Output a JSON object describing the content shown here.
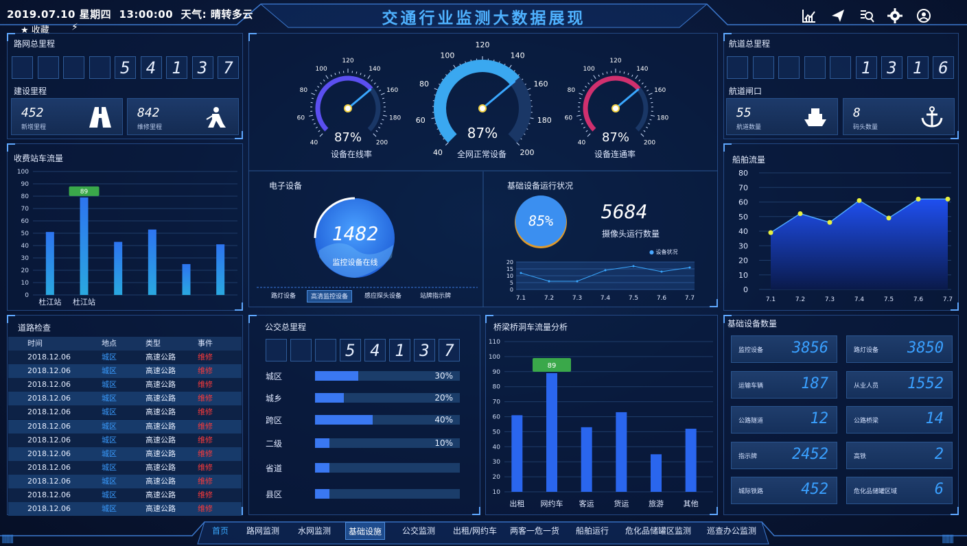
{
  "header": {
    "datetime": "2019.07.10 星期四  13:00:00  天气: 晴转多云",
    "title": "交通行业监测大数据展现",
    "favorites": "收藏"
  },
  "icons": [
    "chart-icon",
    "send-icon",
    "search-icon",
    "settings-icon",
    "user-icon"
  ],
  "road_total": {
    "title": "路网总里程",
    "digits": [
      "",
      "",
      "",
      "",
      "5",
      "4",
      "1",
      "3",
      "7"
    ]
  },
  "construction": {
    "title": "建设里程",
    "cards": [
      {
        "value": "452",
        "label": "新增里程",
        "icon": "road-icon"
      },
      {
        "value": "842",
        "label": "维修里程",
        "icon": "worker-icon"
      }
    ]
  },
  "toll": {
    "title": "收费站车流量",
    "chart_data": {
      "type": "bar",
      "categories": [
        "杜江站",
        "杜江站",
        "",
        "",
        "",
        ""
      ],
      "values": [
        51,
        79,
        43,
        53,
        25,
        41
      ],
      "ylim": [
        0,
        100
      ],
      "yticks": [
        0,
        10,
        20,
        30,
        40,
        50,
        60,
        70,
        80,
        90,
        100
      ],
      "highlight": {
        "index": 1,
        "label": "89"
      }
    }
  },
  "road_check": {
    "title": "道路检查",
    "headers": [
      "时间",
      "地点",
      "类型",
      "事件"
    ],
    "rows": [
      [
        "2018.12.06",
        "城区",
        "高速公路",
        "维修"
      ],
      [
        "2018.12.06",
        "城区",
        "高速公路",
        "维修"
      ],
      [
        "2018.12.06",
        "城区",
        "高速公路",
        "维修"
      ],
      [
        "2018.12.06",
        "城区",
        "高速公路",
        "维修"
      ],
      [
        "2018.12.06",
        "城区",
        "高速公路",
        "维修"
      ],
      [
        "2018.12.06",
        "城区",
        "高速公路",
        "维修"
      ],
      [
        "2018.12.06",
        "城区",
        "高速公路",
        "维修"
      ],
      [
        "2018.12.06",
        "城区",
        "高速公路",
        "维修"
      ],
      [
        "2018.12.06",
        "城区",
        "高速公路",
        "维修"
      ],
      [
        "2018.12.06",
        "城区",
        "高速公路",
        "维修"
      ],
      [
        "2018.12.06",
        "城区",
        "高速公路",
        "维修"
      ],
      [
        "2018.12.06",
        "城区",
        "高速公路",
        "维修"
      ]
    ]
  },
  "gauges": [
    {
      "label": "设备在线率",
      "value": "87%",
      "color": "#5b4ff0",
      "ticks": [
        "40",
        "60",
        "80",
        "100",
        "120",
        "140",
        "160",
        "180",
        "200"
      ]
    },
    {
      "label": "全网正常设备",
      "value": "87%",
      "color": "#3aa8f0",
      "ticks": [
        "40",
        "60",
        "80",
        "100",
        "120",
        "140",
        "160",
        "180",
        "200"
      ]
    },
    {
      "label": "设备连通率",
      "value": "87%",
      "color": "#d0306e",
      "ticks": [
        "40",
        "60",
        "80",
        "100",
        "120",
        "140",
        "160",
        "180",
        "200"
      ]
    }
  ],
  "electronic": {
    "title": "电子设备",
    "value": "1482",
    "label": "监控设备在线",
    "tabs": [
      "路灯设备",
      "高清监控设备",
      "感应探头设备",
      "站牌指示牌"
    ],
    "active_tab": 1
  },
  "infra_status": {
    "title": "基础设备运行状况",
    "percent": "85%",
    "camera_count": "5684",
    "camera_label": "摄像头运行数量",
    "legend": "设备状况",
    "chart_data": {
      "type": "line",
      "x": [
        "7.1",
        "7.2",
        "7.3",
        "7.4",
        "7.5",
        "7.6",
        "7.7"
      ],
      "values": [
        12,
        6,
        6,
        14,
        17,
        13,
        16
      ],
      "ylim": [
        0,
        20
      ],
      "yticks": [
        "0",
        "5",
        "10",
        "15",
        "20"
      ]
    }
  },
  "bus": {
    "title": "公交总里程",
    "digits": [
      "",
      "",
      "",
      "5",
      "4",
      "1",
      "3",
      "7"
    ],
    "rows": [
      {
        "label": "城区",
        "pct": 30,
        "text": "30%"
      },
      {
        "label": "城乡",
        "pct": 20,
        "text": "20%"
      },
      {
        "label": "跨区",
        "pct": 40,
        "text": "40%"
      },
      {
        "label": "二级",
        "pct": 10,
        "text": "10%"
      },
      {
        "label": "省道",
        "pct": 10,
        "text": ""
      },
      {
        "label": "县区",
        "pct": 10,
        "text": ""
      }
    ]
  },
  "bridge": {
    "title": "桥梁桥洞车流量分析",
    "chart_data": {
      "type": "bar",
      "categories": [
        "出租",
        "网约车",
        "客运",
        "货运",
        "旅游",
        "其他"
      ],
      "values": [
        61,
        89,
        53,
        63,
        35,
        52
      ],
      "ylim": [
        10,
        110
      ],
      "yticks": [
        10,
        20,
        30,
        40,
        50,
        60,
        70,
        80,
        90,
        100,
        110
      ],
      "highlight": {
        "index": 1,
        "label": "89"
      }
    }
  },
  "waterway": {
    "title": "航道总里程",
    "digits": [
      "",
      "",
      "",
      "",
      "",
      "1",
      "3",
      "1",
      "6"
    ],
    "gate_title": "航道闸口",
    "cards": [
      {
        "value": "55",
        "label": "航道数量",
        "icon": "ship-icon"
      },
      {
        "value": "8",
        "label": "码头数量",
        "icon": "anchor-icon"
      }
    ]
  },
  "ship": {
    "title": "船舶流量",
    "chart_data": {
      "type": "area",
      "x": [
        "7.1",
        "7.2",
        "7.3",
        "7.4",
        "7.5",
        "7.6",
        "7.7"
      ],
      "values": [
        39,
        52,
        46,
        61,
        49,
        62,
        62
      ],
      "ylim": [
        0,
        80
      ],
      "yticks": [
        0,
        10,
        20,
        30,
        40,
        50,
        60,
        70,
        80
      ]
    }
  },
  "base_counts": {
    "title": "基础设备数量",
    "items": [
      {
        "label": "监控设备",
        "value": "3856"
      },
      {
        "label": "路灯设备",
        "value": "3850"
      },
      {
        "label": "运输车辆",
        "value": "187"
      },
      {
        "label": "从业人员",
        "value": "1552"
      },
      {
        "label": "公路隧道",
        "value": "12"
      },
      {
        "label": "公路桥梁",
        "value": "14"
      },
      {
        "label": "指示牌",
        "value": "2452"
      },
      {
        "label": "高铁",
        "value": "2"
      },
      {
        "label": "城际铁路",
        "value": "452"
      },
      {
        "label": "危化品储罐区域",
        "value": "6"
      }
    ]
  },
  "nav": [
    "首页",
    "路网监测",
    "水网监测",
    "基础设施",
    "公交监测",
    "出租/网约车",
    "两客一危一货",
    "船舶运行",
    "危化品储罐区监测",
    "巡查办公监测"
  ],
  "nav_active": 3
}
